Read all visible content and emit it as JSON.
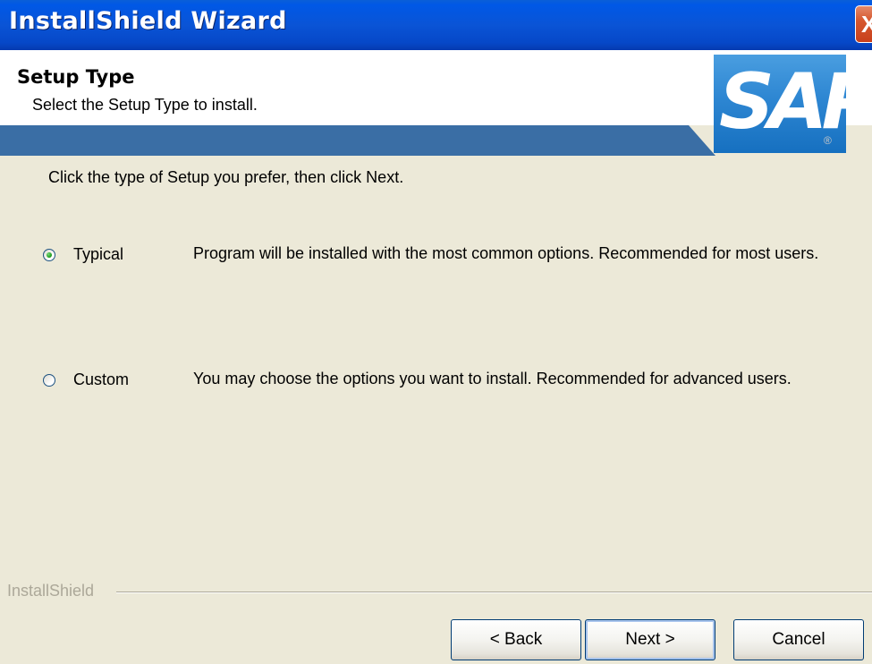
{
  "window": {
    "title": "InstallShield Wizard",
    "close_label": "X"
  },
  "header": {
    "title": "Setup Type",
    "subtitle": "Select the Setup Type to install.",
    "logo_text": "SAP",
    "logo_mark": "®"
  },
  "main": {
    "instruction": "Click the type of Setup you prefer, then click Next.",
    "options": [
      {
        "label": "Typical",
        "description": "Program will be installed with the most common options.  Recommended for most users.",
        "selected": true
      },
      {
        "label": "Custom",
        "description": "You may choose the options you want to install. Recommended for advanced users.",
        "selected": false
      }
    ]
  },
  "footer": {
    "brand": "InstallShield",
    "back_label": "< Back",
    "next_label": "Next >",
    "cancel_label": "Cancel"
  },
  "colors": {
    "title_bar": "#0a54d6",
    "header_band": "#3a6ea5",
    "logo_blue": "#2d86d2",
    "window_bg": "#ece9d8"
  }
}
